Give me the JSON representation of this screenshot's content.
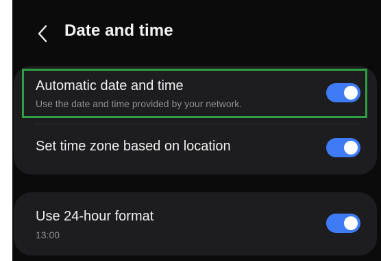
{
  "header": {
    "back_icon": "chevron-left-icon",
    "title": "Date and time"
  },
  "settings": {
    "automatic_date_time": {
      "title": "Automatic date and time",
      "subtitle": "Use the date and time provided by your network.",
      "enabled": true
    },
    "time_zone_location": {
      "title": "Set time zone based on location",
      "enabled": true
    },
    "hour_format_24": {
      "title": "Use 24-hour format",
      "subtitle": "13:00",
      "enabled": true
    }
  },
  "colors": {
    "background": "#0b0b0c",
    "card": "#1d1d1f",
    "toggle_on": "#3e7bf4",
    "highlight": "#2ea043"
  }
}
